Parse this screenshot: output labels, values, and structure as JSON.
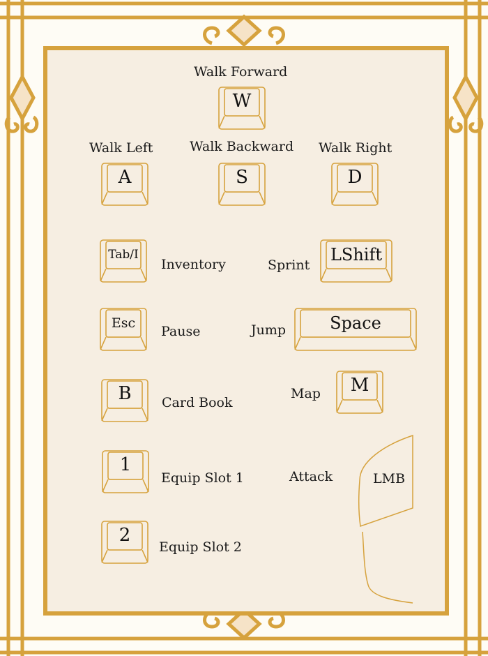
{
  "colors": {
    "gold": "#d6a23d",
    "panel": "#f6eee2",
    "page": "#fefcf5",
    "diamond": "#f6e3c7"
  },
  "movement": {
    "forward_label": "Walk Forward",
    "forward_key": "W",
    "left_label": "Walk Left",
    "left_key": "A",
    "backward_label": "Walk Backward",
    "backward_key": "S",
    "right_label": "Walk Right",
    "right_key": "D"
  },
  "bindings": {
    "inventory_key": "Tab/I",
    "inventory_label": "Inventory",
    "sprint_label": "Sprint",
    "sprint_key": "LShift",
    "pause_key": "Esc",
    "pause_label": "Pause",
    "jump_label": "Jump",
    "jump_key": "Space",
    "cardbook_key": "B",
    "cardbook_label": "Card Book",
    "map_label": "Map",
    "map_key": "M",
    "slot1_key": "1",
    "slot1_label": "Equip Slot 1",
    "attack_label": "Attack",
    "attack_key": "LMB",
    "slot2_key": "2",
    "slot2_label": "Equip Slot 2"
  }
}
